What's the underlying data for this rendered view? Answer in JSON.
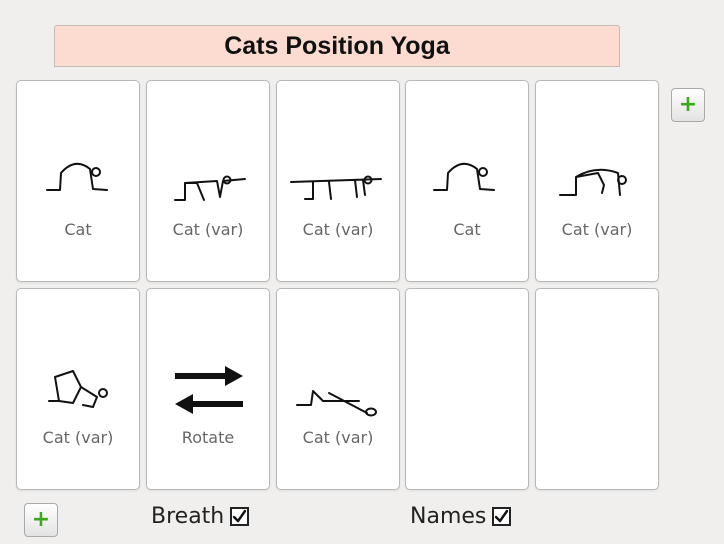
{
  "title": "Cats Position Yoga",
  "poses": [
    {
      "label": "Cat",
      "figure": "cat-arch-figure"
    },
    {
      "label": "Cat (var)",
      "figure": "cat-flat-back-figure"
    },
    {
      "label": "Cat (var)",
      "figure": "cat-tabletop-figure"
    },
    {
      "label": "Cat",
      "figure": "cat-arch-figure"
    },
    {
      "label": "Cat (var)",
      "figure": "cat-curl-figure"
    },
    {
      "label": "Cat (var)",
      "figure": "cat-leg-lift-figure"
    },
    {
      "label": "Rotate",
      "figure": "rotate-arrows-icon"
    },
    {
      "label": "Cat (var)",
      "figure": "cat-stretch-figure"
    },
    {
      "label": "",
      "figure": ""
    },
    {
      "label": "",
      "figure": ""
    }
  ],
  "controls": {
    "add_row_button": "plus-icon",
    "add_pose_button": "plus-icon",
    "breath_label": "Breath",
    "breath_checked": true,
    "names_label": "Names",
    "names_checked": true
  },
  "colors": {
    "title_background": "#fcdcd0",
    "plus": "#3aaa1c",
    "card_border": "#b8b8b8",
    "label_text": "#666666"
  }
}
